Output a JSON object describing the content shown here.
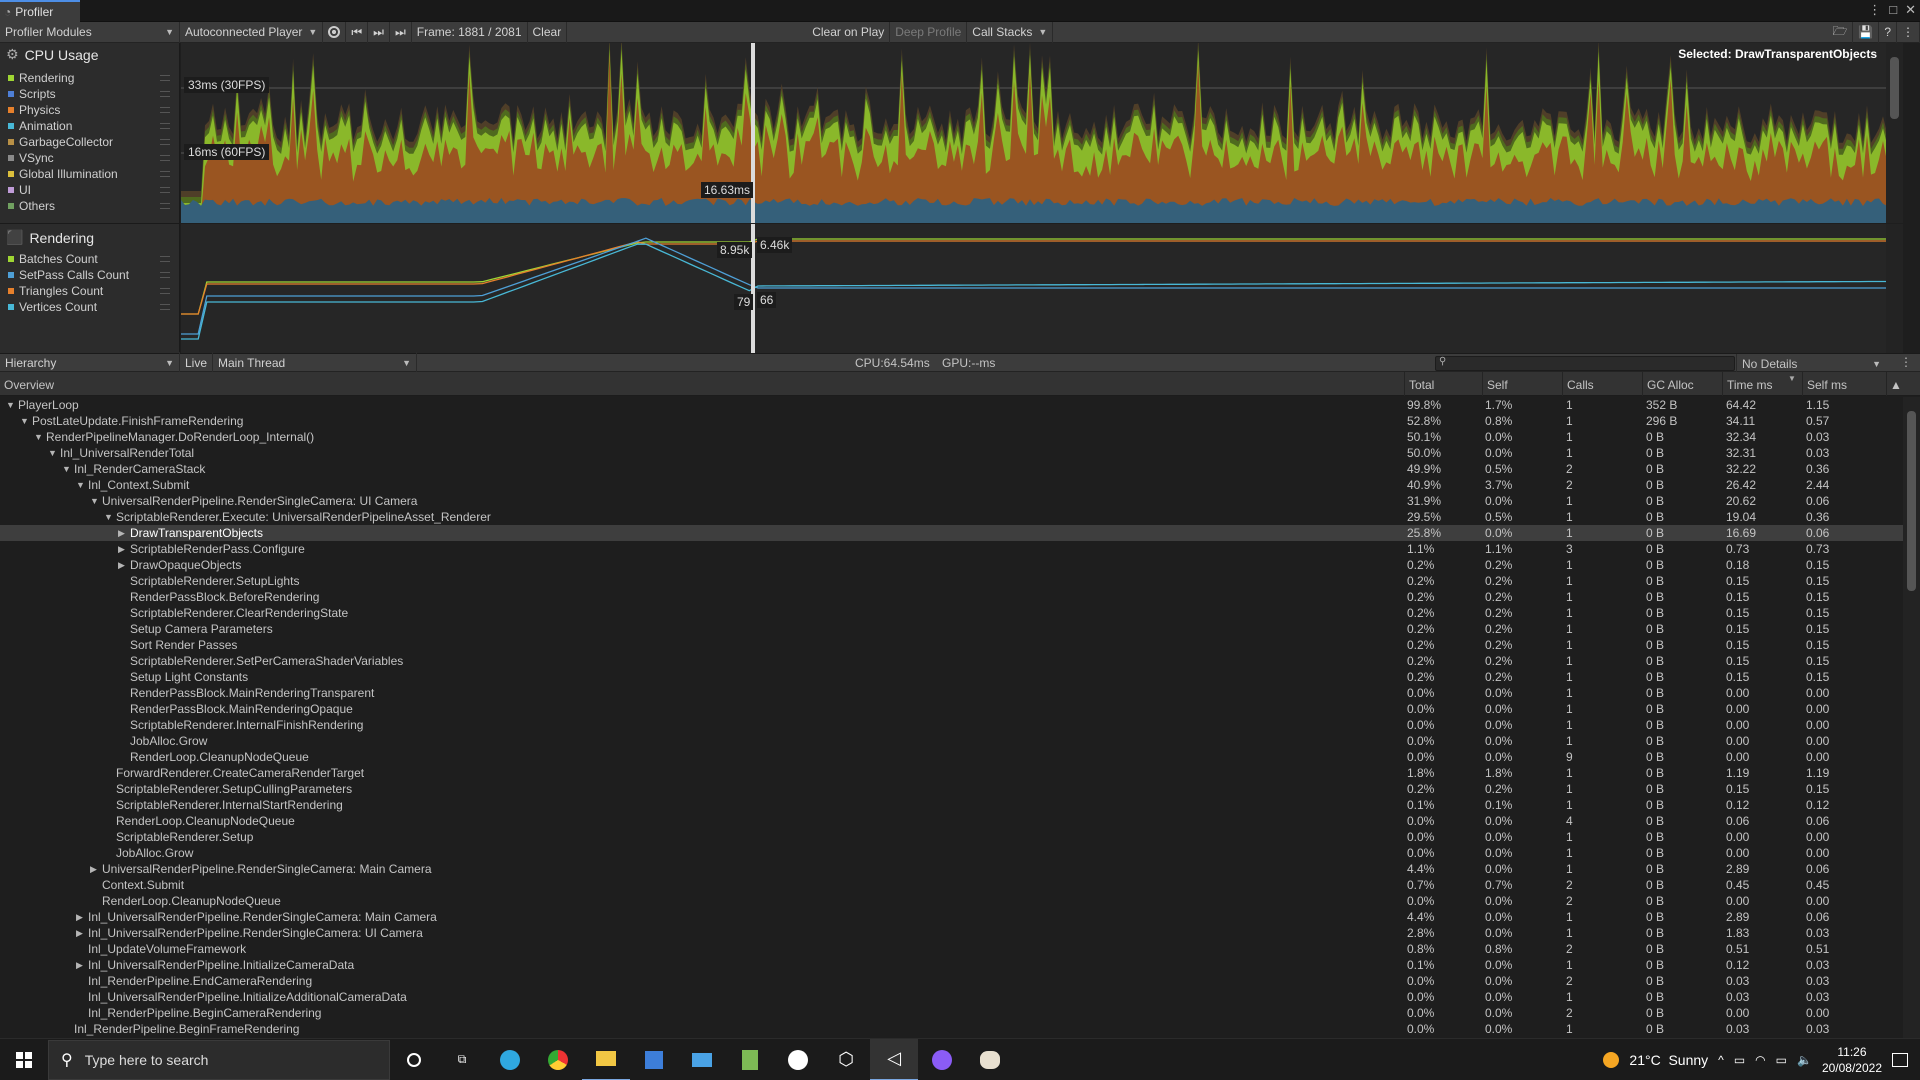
{
  "window": {
    "tab_title": "Profiler"
  },
  "toolbar": {
    "modules": "Profiler Modules",
    "player": "Autoconnected Player",
    "frame": "Frame: 1881 / 2081",
    "clear": "Clear",
    "clear_on_play": "Clear on Play",
    "deep_profile": "Deep Profile",
    "call_stacks": "Call Stacks"
  },
  "selected_label": "Selected: DrawTransparentObjects",
  "cpu_module": {
    "title": "CPU Usage",
    "legend": [
      {
        "label": "Rendering",
        "color": "#9fd633"
      },
      {
        "label": "Scripts",
        "color": "#4e7fd6"
      },
      {
        "label": "Physics",
        "color": "#e6802c"
      },
      {
        "label": "Animation",
        "color": "#48b8d6"
      },
      {
        "label": "GarbageCollector",
        "color": "#b89046"
      },
      {
        "label": "VSync",
        "color": "#8a8a8a"
      },
      {
        "label": "Global Illumination",
        "color": "#dbbf3c"
      },
      {
        "label": "UI",
        "color": "#c09cd8"
      },
      {
        "label": "Others",
        "color": "#70a060"
      }
    ],
    "marker_30": "33ms (30FPS)",
    "marker_60": "16ms (60FPS)",
    "cursor_value": "16.63ms"
  },
  "render_module": {
    "title": "Rendering",
    "legend": [
      {
        "label": "Batches Count",
        "color": "#9fd633"
      },
      {
        "label": "SetPass Calls Count",
        "color": "#4e9fd6"
      },
      {
        "label": "Triangles Count",
        "color": "#e6802c"
      },
      {
        "label": "Vertices Count",
        "color": "#48b8d6"
      }
    ],
    "v1": "8.95k",
    "v2": "6.46k",
    "v3": "79",
    "v4": "66"
  },
  "bottom": {
    "view": "Hierarchy",
    "live": "Live",
    "thread": "Main Thread",
    "cpu": "CPU:64.54ms",
    "gpu": "GPU:--ms",
    "details": "No Details"
  },
  "columns": [
    "Overview",
    "Total",
    "Self",
    "Calls",
    "GC Alloc",
    "Time ms",
    "Self ms"
  ],
  "rows": [
    {
      "name": "PlayerLoop",
      "d": 0,
      "t": "open",
      "total": "99.8%",
      "self": "1.7%",
      "calls": "1",
      "gc": "352 B",
      "time": "64.42",
      "selfms": "1.15"
    },
    {
      "name": "PostLateUpdate.FinishFrameRendering",
      "d": 1,
      "t": "open",
      "total": "52.8%",
      "self": "0.8%",
      "calls": "1",
      "gc": "296 B",
      "time": "34.11",
      "selfms": "0.57"
    },
    {
      "name": "RenderPipelineManager.DoRenderLoop_Internal()",
      "d": 2,
      "t": "open",
      "total": "50.1%",
      "self": "0.0%",
      "calls": "1",
      "gc": "0 B",
      "time": "32.34",
      "selfms": "0.03"
    },
    {
      "name": "Inl_UniversalRenderTotal",
      "d": 3,
      "t": "open",
      "total": "50.0%",
      "self": "0.0%",
      "calls": "1",
      "gc": "0 B",
      "time": "32.31",
      "selfms": "0.03"
    },
    {
      "name": "Inl_RenderCameraStack",
      "d": 4,
      "t": "open",
      "total": "49.9%",
      "self": "0.5%",
      "calls": "2",
      "gc": "0 B",
      "time": "32.22",
      "selfms": "0.36"
    },
    {
      "name": "Inl_Context.Submit",
      "d": 5,
      "t": "open",
      "total": "40.9%",
      "self": "3.7%",
      "calls": "2",
      "gc": "0 B",
      "time": "26.42",
      "selfms": "2.44"
    },
    {
      "name": "UniversalRenderPipeline.RenderSingleCamera: UI Camera",
      "d": 6,
      "t": "open",
      "total": "31.9%",
      "self": "0.0%",
      "calls": "1",
      "gc": "0 B",
      "time": "20.62",
      "selfms": "0.06"
    },
    {
      "name": "ScriptableRenderer.Execute: UniversalRenderPipelineAsset_Renderer",
      "d": 7,
      "t": "open",
      "total": "29.5%",
      "self": "0.5%",
      "calls": "1",
      "gc": "0 B",
      "time": "19.04",
      "selfms": "0.36"
    },
    {
      "name": "DrawTransparentObjects",
      "d": 8,
      "t": "closed",
      "sel": true,
      "total": "25.8%",
      "self": "0.0%",
      "calls": "1",
      "gc": "0 B",
      "time": "16.69",
      "selfms": "0.06"
    },
    {
      "name": "ScriptableRenderPass.Configure",
      "d": 8,
      "t": "closed",
      "total": "1.1%",
      "self": "1.1%",
      "calls": "3",
      "gc": "0 B",
      "time": "0.73",
      "selfms": "0.73"
    },
    {
      "name": "DrawOpaqueObjects",
      "d": 8,
      "t": "closed",
      "total": "0.2%",
      "self": "0.2%",
      "calls": "1",
      "gc": "0 B",
      "time": "0.18",
      "selfms": "0.15"
    },
    {
      "name": "ScriptableRenderer.SetupLights",
      "d": 8,
      "t": "",
      "total": "0.2%",
      "self": "0.2%",
      "calls": "1",
      "gc": "0 B",
      "time": "0.15",
      "selfms": "0.15"
    },
    {
      "name": "RenderPassBlock.BeforeRendering",
      "d": 8,
      "t": "",
      "total": "0.2%",
      "self": "0.2%",
      "calls": "1",
      "gc": "0 B",
      "time": "0.15",
      "selfms": "0.15"
    },
    {
      "name": "ScriptableRenderer.ClearRenderingState",
      "d": 8,
      "t": "",
      "total": "0.2%",
      "self": "0.2%",
      "calls": "1",
      "gc": "0 B",
      "time": "0.15",
      "selfms": "0.15"
    },
    {
      "name": "Setup Camera Parameters",
      "d": 8,
      "t": "",
      "total": "0.2%",
      "self": "0.2%",
      "calls": "1",
      "gc": "0 B",
      "time": "0.15",
      "selfms": "0.15"
    },
    {
      "name": "Sort Render Passes",
      "d": 8,
      "t": "",
      "total": "0.2%",
      "self": "0.2%",
      "calls": "1",
      "gc": "0 B",
      "time": "0.15",
      "selfms": "0.15"
    },
    {
      "name": "ScriptableRenderer.SetPerCameraShaderVariables",
      "d": 8,
      "t": "",
      "total": "0.2%",
      "self": "0.2%",
      "calls": "1",
      "gc": "0 B",
      "time": "0.15",
      "selfms": "0.15"
    },
    {
      "name": "Setup Light Constants",
      "d": 8,
      "t": "",
      "total": "0.2%",
      "self": "0.2%",
      "calls": "1",
      "gc": "0 B",
      "time": "0.15",
      "selfms": "0.15"
    },
    {
      "name": "RenderPassBlock.MainRenderingTransparent",
      "d": 8,
      "t": "",
      "total": "0.0%",
      "self": "0.0%",
      "calls": "1",
      "gc": "0 B",
      "time": "0.00",
      "selfms": "0.00"
    },
    {
      "name": "RenderPassBlock.MainRenderingOpaque",
      "d": 8,
      "t": "",
      "total": "0.0%",
      "self": "0.0%",
      "calls": "1",
      "gc": "0 B",
      "time": "0.00",
      "selfms": "0.00"
    },
    {
      "name": "ScriptableRenderer.InternalFinishRendering",
      "d": 8,
      "t": "",
      "total": "0.0%",
      "self": "0.0%",
      "calls": "1",
      "gc": "0 B",
      "time": "0.00",
      "selfms": "0.00"
    },
    {
      "name": "JobAlloc.Grow",
      "d": 8,
      "t": "",
      "total": "0.0%",
      "self": "0.0%",
      "calls": "1",
      "gc": "0 B",
      "time": "0.00",
      "selfms": "0.00"
    },
    {
      "name": "RenderLoop.CleanupNodeQueue",
      "d": 8,
      "t": "",
      "total": "0.0%",
      "self": "0.0%",
      "calls": "9",
      "gc": "0 B",
      "time": "0.00",
      "selfms": "0.00"
    },
    {
      "name": "ForwardRenderer.CreateCameraRenderTarget",
      "d": 7,
      "t": "",
      "total": "1.8%",
      "self": "1.8%",
      "calls": "1",
      "gc": "0 B",
      "time": "1.19",
      "selfms": "1.19"
    },
    {
      "name": "ScriptableRenderer.SetupCullingParameters",
      "d": 7,
      "t": "",
      "total": "0.2%",
      "self": "0.2%",
      "calls": "1",
      "gc": "0 B",
      "time": "0.15",
      "selfms": "0.15"
    },
    {
      "name": "ScriptableRenderer.InternalStartRendering",
      "d": 7,
      "t": "",
      "total": "0.1%",
      "self": "0.1%",
      "calls": "1",
      "gc": "0 B",
      "time": "0.12",
      "selfms": "0.12"
    },
    {
      "name": "RenderLoop.CleanupNodeQueue",
      "d": 7,
      "t": "",
      "total": "0.0%",
      "self": "0.0%",
      "calls": "4",
      "gc": "0 B",
      "time": "0.06",
      "selfms": "0.06"
    },
    {
      "name": "ScriptableRenderer.Setup",
      "d": 7,
      "t": "",
      "total": "0.0%",
      "self": "0.0%",
      "calls": "1",
      "gc": "0 B",
      "time": "0.00",
      "selfms": "0.00"
    },
    {
      "name": "JobAlloc.Grow",
      "d": 7,
      "t": "",
      "total": "0.0%",
      "self": "0.0%",
      "calls": "1",
      "gc": "0 B",
      "time": "0.00",
      "selfms": "0.00"
    },
    {
      "name": "UniversalRenderPipeline.RenderSingleCamera: Main Camera",
      "d": 6,
      "t": "closed",
      "total": "4.4%",
      "self": "0.0%",
      "calls": "1",
      "gc": "0 B",
      "time": "2.89",
      "selfms": "0.06"
    },
    {
      "name": "Context.Submit",
      "d": 6,
      "t": "",
      "total": "0.7%",
      "self": "0.7%",
      "calls": "2",
      "gc": "0 B",
      "time": "0.45",
      "selfms": "0.45"
    },
    {
      "name": "RenderLoop.CleanupNodeQueue",
      "d": 6,
      "t": "",
      "total": "0.0%",
      "self": "0.0%",
      "calls": "2",
      "gc": "0 B",
      "time": "0.00",
      "selfms": "0.00"
    },
    {
      "name": "Inl_UniversalRenderPipeline.RenderSingleCamera: Main Camera",
      "d": 5,
      "t": "closed",
      "total": "4.4%",
      "self": "0.0%",
      "calls": "1",
      "gc": "0 B",
      "time": "2.89",
      "selfms": "0.06"
    },
    {
      "name": "Inl_UniversalRenderPipeline.RenderSingleCamera: UI Camera",
      "d": 5,
      "t": "closed",
      "total": "2.8%",
      "self": "0.0%",
      "calls": "1",
      "gc": "0 B",
      "time": "1.83",
      "selfms": "0.03"
    },
    {
      "name": "Inl_UpdateVolumeFramework",
      "d": 5,
      "t": "",
      "total": "0.8%",
      "self": "0.8%",
      "calls": "2",
      "gc": "0 B",
      "time": "0.51",
      "selfms": "0.51"
    },
    {
      "name": "Inl_UniversalRenderPipeline.InitializeCameraData",
      "d": 5,
      "t": "closed",
      "total": "0.1%",
      "self": "0.0%",
      "calls": "1",
      "gc": "0 B",
      "time": "0.12",
      "selfms": "0.03"
    },
    {
      "name": "Inl_RenderPipeline.EndCameraRendering",
      "d": 5,
      "t": "",
      "total": "0.0%",
      "self": "0.0%",
      "calls": "2",
      "gc": "0 B",
      "time": "0.03",
      "selfms": "0.03"
    },
    {
      "name": "Inl_UniversalRenderPipeline.InitializeAdditionalCameraData",
      "d": 5,
      "t": "",
      "total": "0.0%",
      "self": "0.0%",
      "calls": "1",
      "gc": "0 B",
      "time": "0.03",
      "selfms": "0.03"
    },
    {
      "name": "Inl_RenderPipeline.BeginCameraRendering",
      "d": 5,
      "t": "",
      "total": "0.0%",
      "self": "0.0%",
      "calls": "2",
      "gc": "0 B",
      "time": "0.00",
      "selfms": "0.00"
    },
    {
      "name": "Inl_RenderPipeline.BeginFrameRendering",
      "d": 4,
      "t": "",
      "total": "0.0%",
      "self": "0.0%",
      "calls": "1",
      "gc": "0 B",
      "time": "0.03",
      "selfms": "0.03"
    }
  ],
  "taskbar": {
    "search_placeholder": "Type here to search",
    "weather": "21°C  Sunny",
    "time": "11:26",
    "date": "20/08/2022"
  }
}
